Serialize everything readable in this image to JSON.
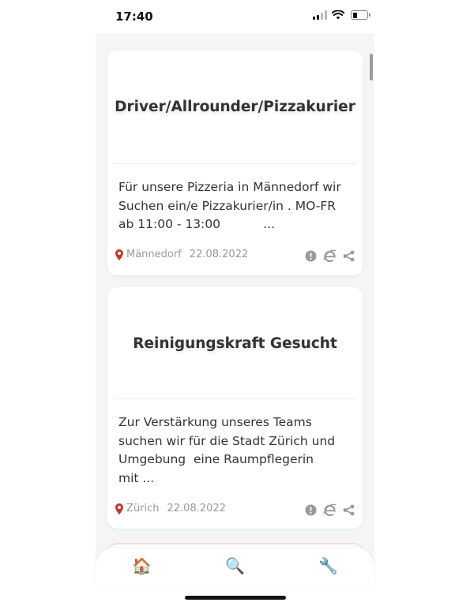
{
  "status_bar": {
    "time": "17:40"
  },
  "listings": [
    {
      "title": "Driver/Allrounder/Pizzakurier",
      "description": "Für unsere Pizzeria in Männedorf wir\nSuchen ein/e Pizzakurier/in . MO-FR\nab 11:00 - 13:00           ...",
      "location": "Männedorf",
      "date": "22.08.2022"
    },
    {
      "title": "Reinigungskraft Gesucht",
      "description": "Zur Verstärkung unseres Teams\nsuchen wir für die Stadt Zürich und\nUmgebung  eine Raumpflegerin\nmit ...",
      "location": "Zürich",
      "date": "22.08.2022"
    }
  ],
  "bottom_nav": {
    "home_icon": "🏠",
    "search_icon": "🔍",
    "settings_icon": "🔧"
  },
  "colors": {
    "pin": "#c0392b",
    "action_icon": "#9a9a9a"
  }
}
